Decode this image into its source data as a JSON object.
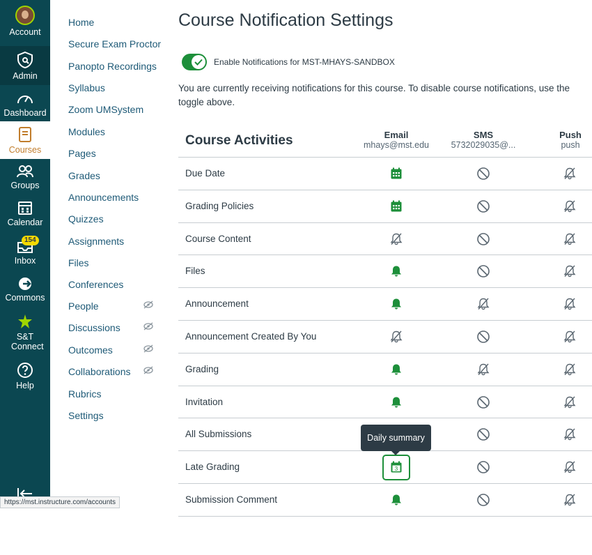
{
  "global_nav": {
    "items": [
      {
        "label": "Account",
        "icon": "avatar"
      },
      {
        "label": "Admin",
        "icon": "shield-icon"
      },
      {
        "label": "Dashboard",
        "icon": "dashboard-icon"
      },
      {
        "label": "Courses",
        "icon": "book-icon"
      },
      {
        "label": "Groups",
        "icon": "groups-icon"
      },
      {
        "label": "Calendar",
        "icon": "calendar-icon"
      },
      {
        "label": "Inbox",
        "icon": "inbox-icon",
        "badge": "154"
      },
      {
        "label": "Commons",
        "icon": "commons-icon"
      },
      {
        "label": "S&T Connect",
        "icon": "star-icon"
      },
      {
        "label": "Help",
        "icon": "help-icon"
      }
    ],
    "accent": "#c17d2c",
    "background": "#0b4751"
  },
  "course_nav": {
    "items": [
      {
        "label": "Home"
      },
      {
        "label": "Secure Exam Proctor"
      },
      {
        "label": "Panopto Recordings"
      },
      {
        "label": "Syllabus"
      },
      {
        "label": "Zoom UMSystem"
      },
      {
        "label": "Modules"
      },
      {
        "label": "Pages"
      },
      {
        "label": "Grades"
      },
      {
        "label": "Announcements"
      },
      {
        "label": "Quizzes"
      },
      {
        "label": "Assignments"
      },
      {
        "label": "Files"
      },
      {
        "label": "Conferences"
      },
      {
        "label": "People",
        "hidden": true
      },
      {
        "label": "Discussions",
        "hidden": true
      },
      {
        "label": "Outcomes",
        "hidden": true
      },
      {
        "label": "Collaborations",
        "hidden": true
      },
      {
        "label": "Rubrics"
      },
      {
        "label": "Settings"
      }
    ]
  },
  "page": {
    "title": "Course Notification Settings",
    "toggle_label": "Enable Notifications for MST-MHAYS-SANDBOX",
    "toggle_on": true,
    "info": "You are currently receiving notifications for this course. To disable course notifications, use the toggle above."
  },
  "table": {
    "title": "Course Activities",
    "columns": [
      {
        "name": "Email",
        "address": "mhays@mst.edu"
      },
      {
        "name": "SMS",
        "address": "5732029035@..."
      },
      {
        "name": "Push",
        "address": "push"
      }
    ],
    "rows": [
      {
        "label": "Due Date",
        "email": "daily",
        "sms": "disabled",
        "push": "never"
      },
      {
        "label": "Grading Policies",
        "email": "daily",
        "sms": "disabled",
        "push": "never"
      },
      {
        "label": "Course Content",
        "email": "never",
        "sms": "disabled",
        "push": "never"
      },
      {
        "label": "Files",
        "email": "immediate",
        "sms": "disabled",
        "push": "never"
      },
      {
        "label": "Announcement",
        "email": "immediate",
        "sms": "never",
        "push": "never"
      },
      {
        "label": "Announcement Created By You",
        "email": "never",
        "sms": "disabled",
        "push": "never"
      },
      {
        "label": "Grading",
        "email": "immediate",
        "sms": "never",
        "push": "never"
      },
      {
        "label": "Invitation",
        "email": "immediate",
        "sms": "disabled",
        "push": "never"
      },
      {
        "label": "All Submissions",
        "email": "hidden",
        "sms": "disabled",
        "push": "never"
      },
      {
        "label": "Late Grading",
        "email": "daily-focused",
        "email_day": "3",
        "sms": "disabled",
        "push": "never"
      },
      {
        "label": "Submission Comment",
        "email": "immediate",
        "sms": "disabled",
        "push": "never"
      }
    ]
  },
  "tooltip": {
    "text": "Daily summary"
  },
  "status_bar": {
    "url": "https://mst.instructure.com/accounts"
  },
  "colors": {
    "green": "#1d8f3a",
    "link": "#1e5a77",
    "text": "#2d3b45"
  }
}
